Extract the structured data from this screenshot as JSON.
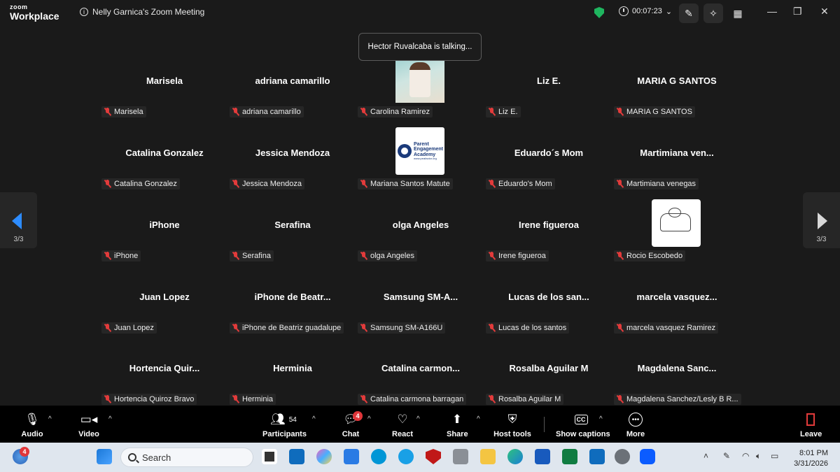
{
  "app": {
    "brand_line1": "zoom",
    "brand_line2": "Workplace",
    "meeting_title": "Nelly Garnica's Zoom Meeting",
    "timer": "00:07:23"
  },
  "toast": "Hector Ruvalcaba is talking...",
  "pagination": {
    "left": "3/3",
    "right": "3/3"
  },
  "tiles": [
    {
      "big": "Marisela",
      "label": "Marisela"
    },
    {
      "big": "adriana camarillo",
      "label": "adriana camarillo"
    },
    {
      "big": "",
      "label": "Carolina Ramirez",
      "avatar": "photo"
    },
    {
      "big": "Liz E.",
      "label": "Liz E."
    },
    {
      "big": "MARIA G SANTOS",
      "label": "MARIA G SANTOS"
    },
    {
      "big": "Catalina Gonzalez",
      "label": "Catalina Gonzalez"
    },
    {
      "big": "Jessica Mendoza",
      "label": "Jessica Mendoza"
    },
    {
      "big": "",
      "label": "Mariana Santos Matute",
      "avatar": "logo",
      "logo_text": [
        "Parent",
        "Engagement",
        "Academy",
        "www.peafactor.org"
      ]
    },
    {
      "big": "Eduardo´s Mom",
      "label": "Eduardo's Mom"
    },
    {
      "big": "Martimiana   ven...",
      "label": "Martimiana  venegas"
    },
    {
      "big": "iPhone",
      "label": "iPhone"
    },
    {
      "big": "Serafina",
      "label": "Serafina"
    },
    {
      "big": "olga Angeles",
      "label": "olga Angeles"
    },
    {
      "big": "Irene figueroa",
      "label": "Irene figueroa"
    },
    {
      "big": "",
      "label": "Rocio Escobedo",
      "avatar": "sketch"
    },
    {
      "big": "Juan Lopez",
      "label": "Juan Lopez"
    },
    {
      "big": "iPhone de Beatr...",
      "label": "iPhone de Beatriz guadalupe"
    },
    {
      "big": "Samsung  SM-A...",
      "label": "Samsung SM-A166U"
    },
    {
      "big": "Lucas de los san...",
      "label": "Lucas de los santos"
    },
    {
      "big": "marcela  vasquez...",
      "label": "marcela vasquez Ramirez"
    },
    {
      "big": "Hortencia   Quir...",
      "label": "Hortencia  Quiroz Bravo"
    },
    {
      "big": "Herminia",
      "label": "Herminia"
    },
    {
      "big": "Catalina  carmon...",
      "label": "Catalina carmona barragan"
    },
    {
      "big": "Rosalba Aguilar M",
      "label": "Rosalba Aguilar M"
    },
    {
      "big": "Magdalena  Sanc...",
      "label": "Magdalena Sanchez/Lesly B R..."
    }
  ],
  "toolbar": {
    "audio": "Audio",
    "video": "Video",
    "participants": "Participants",
    "participants_count": "54",
    "chat": "Chat",
    "chat_badge": "4",
    "react": "React",
    "share": "Share",
    "host_tools": "Host tools",
    "captions": "Show captions",
    "more": "More",
    "leave": "Leave"
  },
  "taskbar": {
    "search_placeholder": "Search",
    "widget_badge": "4",
    "time": "8:01 PM",
    "date": "3/31/2026"
  },
  "colors": {
    "accent": "#2d8cff",
    "muted_mic": "#e23b3b",
    "secure": "#1fb55f",
    "badge": "#e0363a"
  }
}
